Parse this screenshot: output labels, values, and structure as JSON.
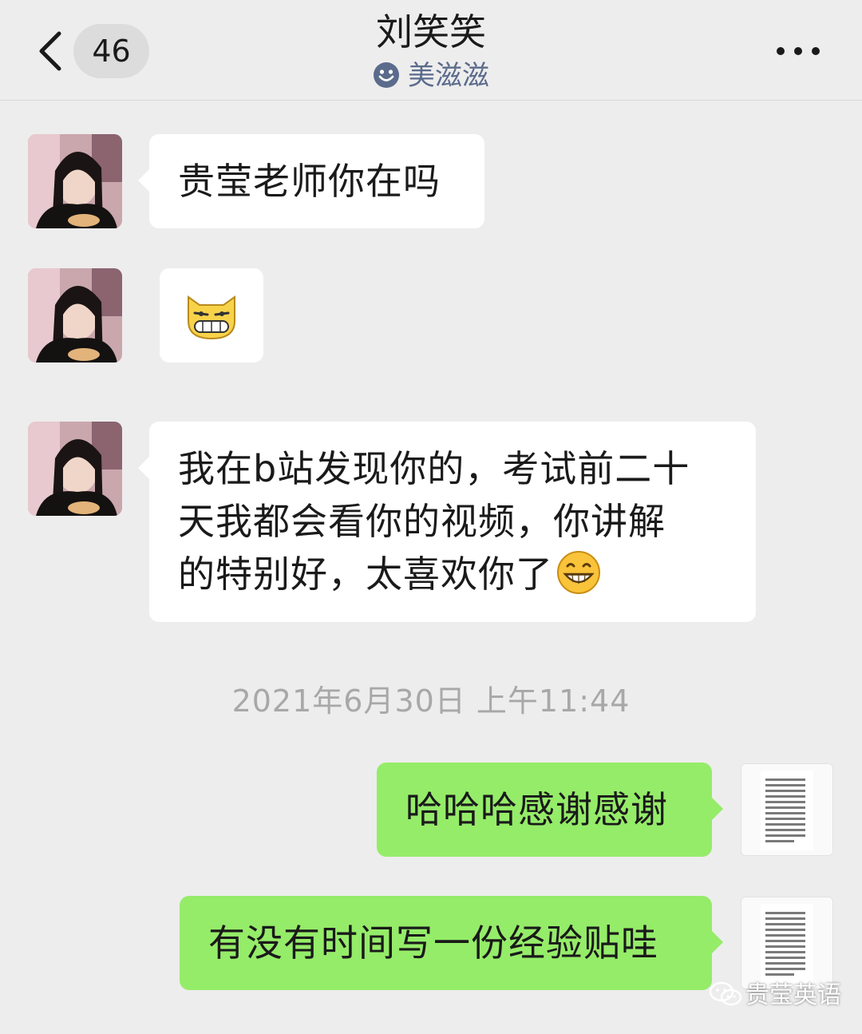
{
  "header": {
    "unread_count": "46",
    "title": "刘笑笑",
    "status_text": "美滋滋"
  },
  "messages": [
    {
      "side": "in",
      "type": "text",
      "text": "贵莹老师你在吗"
    },
    {
      "side": "in",
      "type": "sticker",
      "sticker": "grinning-cat-sticker"
    },
    {
      "side": "in",
      "type": "text",
      "lines": [
        "我在b站发现你的，考试前二十",
        "天我都会看你的视频，你讲解",
        "的特别好，太喜欢你了"
      ],
      "emoji": "grin-emoji"
    },
    {
      "side": "out",
      "type": "text",
      "text": "哈哈哈感谢感谢"
    },
    {
      "side": "out",
      "type": "text",
      "text": "有没有时间写一份经验贴哇"
    }
  ],
  "timestamp": "2021年6月30日 上午11:44",
  "watermark": "贵莹英语",
  "colors": {
    "background": "#ededed",
    "incoming_bubble": "#ffffff",
    "outgoing_bubble": "#95ec69",
    "timestamp": "#a8a8a8",
    "status_text": "#5b6b8c"
  }
}
